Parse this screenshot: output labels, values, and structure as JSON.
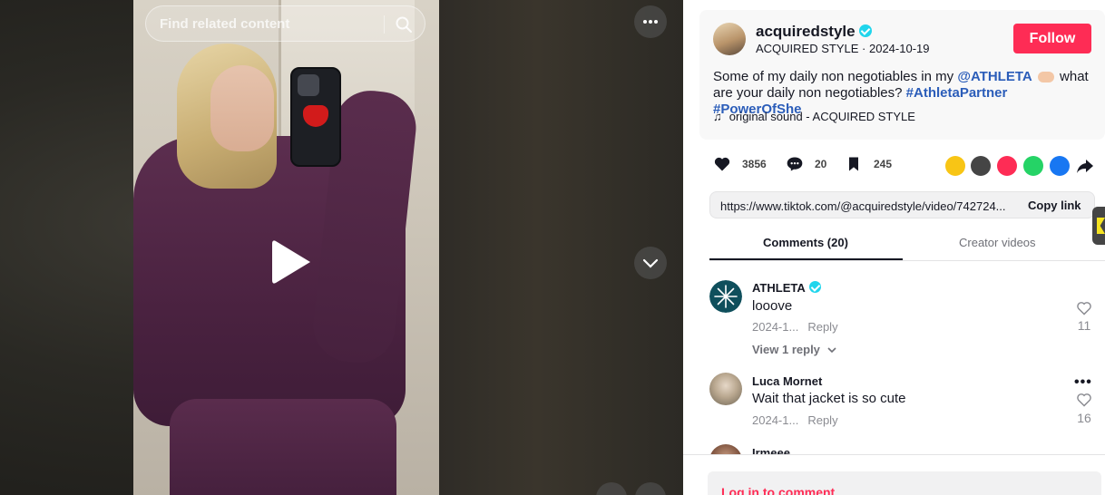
{
  "search": {
    "placeholder": "Find related content"
  },
  "author": {
    "username": "acquiredstyle",
    "nickname": "ACQUIRED STYLE",
    "date": "2024-10-19",
    "follow_label": "Follow"
  },
  "description": {
    "text_1": "Some of my daily non negotiables in my ",
    "mention": "@ATHLETA",
    "text_2": " what are your daily non negotiables? ",
    "hashtag_1": "#AthletaPartner",
    "hashtag_2": "#PowerOfShe"
  },
  "sound": {
    "label": "original sound - ACQUIRED STYLE"
  },
  "stats": {
    "likes": "3856",
    "comments": "20",
    "saves": "245"
  },
  "share_icons": [
    "repost-icon",
    "embed-icon",
    "send-to-friends-icon",
    "whatsapp-icon",
    "facebook-icon",
    "share-icon"
  ],
  "link": {
    "url": "https://www.tiktok.com/@acquiredstyle/video/742724...",
    "copy_label": "Copy link"
  },
  "tabs": [
    {
      "label": "Comments (20)",
      "active": true
    },
    {
      "label": "Creator videos",
      "active": false
    }
  ],
  "comments": [
    {
      "user": "ATHLETA",
      "verified": true,
      "text": "looove",
      "date": "2024-1...",
      "reply": "Reply",
      "likes": "11",
      "view_replies": "View 1 reply"
    },
    {
      "user": "Luca Mornet",
      "verified": false,
      "text": "Wait that jacket is so cute",
      "date": "2024-1...",
      "reply": "Reply",
      "likes": "16"
    },
    {
      "user": "Irmeee",
      "verified": false,
      "text": "",
      "date": "",
      "reply": "",
      "likes": ""
    }
  ],
  "login": {
    "label": "Log in to comment"
  },
  "colors": {
    "brand": "#fe2c55",
    "link": "#2b5db9",
    "verified": "#20d5ec"
  }
}
